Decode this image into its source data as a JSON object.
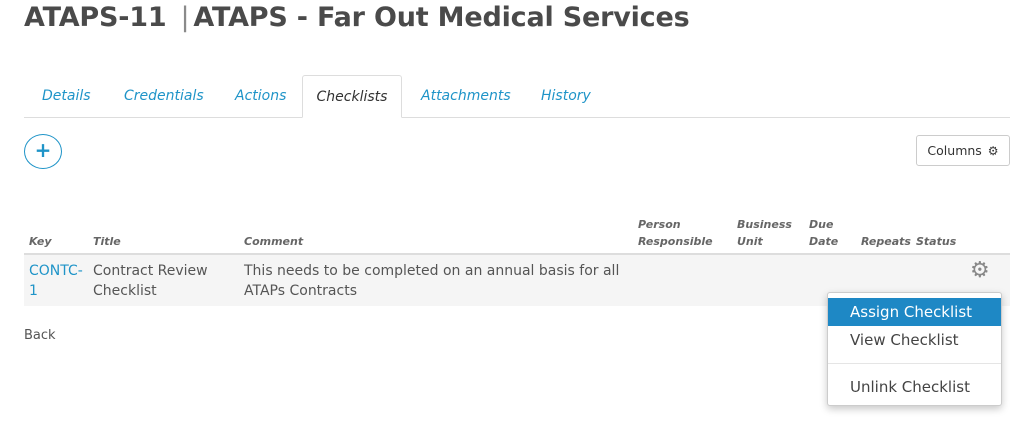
{
  "header": {
    "id": "ATAPS-11",
    "separator": "|",
    "name": "ATAPS - Far Out Medical Services"
  },
  "tabs": [
    {
      "label": "Details",
      "active": false
    },
    {
      "label": "Credentials",
      "active": false
    },
    {
      "label": "Actions",
      "active": false
    },
    {
      "label": "Checklists",
      "active": true
    },
    {
      "label": "Attachments",
      "active": false
    },
    {
      "label": "History",
      "active": false
    }
  ],
  "toolbar": {
    "add_icon": "+",
    "columns_label": "Columns",
    "columns_icon": "gear-icon"
  },
  "table": {
    "headers": {
      "key": "Key",
      "title": "Title",
      "comment": "Comment",
      "person_line1": "Person",
      "person_line2": "Responsible",
      "unit_line1": "Business",
      "unit_line2": "Unit",
      "due_line1": "Due",
      "due_line2": "Date",
      "repeats": "Repeats",
      "status": "Status"
    },
    "rows": [
      {
        "key_line1": "CONTC-",
        "key_line2": "1",
        "title_line1": "Contract Review",
        "title_line2": "Checklist",
        "comment_line1": "This needs to be completed on an annual basis for all",
        "comment_line2": "ATAPs Contracts"
      }
    ]
  },
  "back_label": "Back",
  "context_menu": {
    "items": [
      {
        "label": "Assign Checklist",
        "highlighted": true
      },
      {
        "label": "View Checklist",
        "highlighted": false
      },
      {
        "label": "Unlink Checklist",
        "highlighted": false
      }
    ]
  },
  "colors": {
    "link": "#1f94c8",
    "menu_highlight": "#1e88c5",
    "title": "#4a4a4a",
    "row_bg": "#f5f5f5"
  }
}
